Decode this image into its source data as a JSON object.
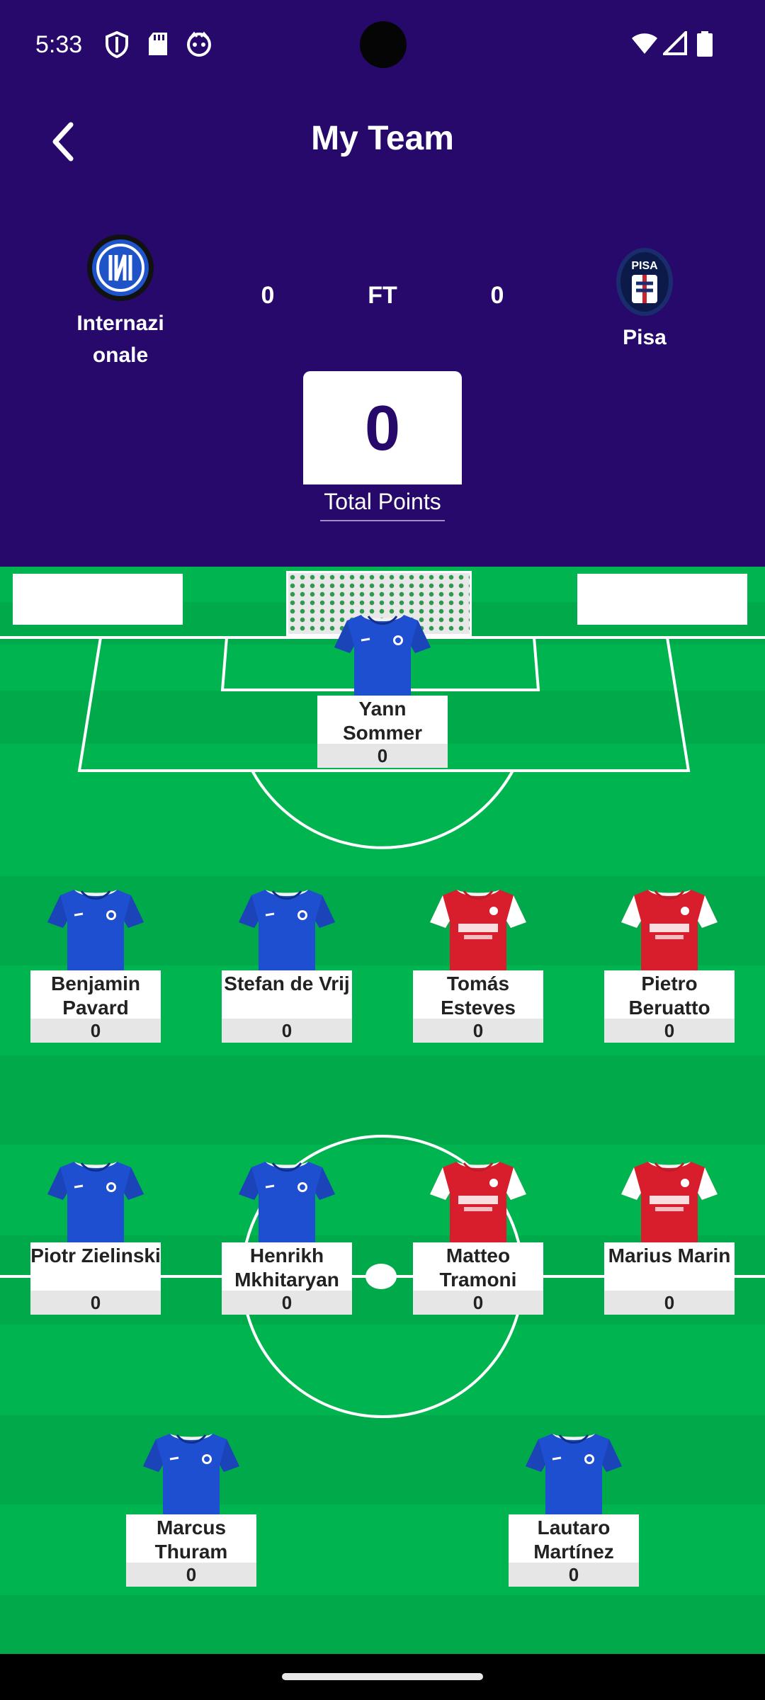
{
  "status_bar": {
    "time": "5:33",
    "left_icons": [
      "shield-icon",
      "sd-card-icon",
      "face-icon"
    ],
    "right_icons": [
      "wifi-icon",
      "signal-icon",
      "battery-icon"
    ]
  },
  "header": {
    "title": "My Team",
    "back_icon": "chevron-left-icon",
    "background": "#26096b"
  },
  "match": {
    "home_team": "Internazi onale",
    "away_team": "Pisa",
    "home_score": "0",
    "away_score": "0",
    "status": "FT"
  },
  "total_points": {
    "value": "0",
    "label": "Total Points"
  },
  "pitch_colors": {
    "light": "#00b44f",
    "dark": "#00a94a"
  },
  "players": [
    {
      "name": "Yann Sommer",
      "points": "0",
      "kit": "blue"
    },
    {
      "name": "Benjamin Pavard",
      "points": "0",
      "kit": "blue"
    },
    {
      "name": "Stefan de Vrij",
      "points": "0",
      "kit": "blue"
    },
    {
      "name": "Tomás Esteves",
      "points": "0",
      "kit": "red"
    },
    {
      "name": "Pietro Beruatto",
      "points": "0",
      "kit": "red"
    },
    {
      "name": "Piotr Zielinski",
      "points": "0",
      "kit": "blue"
    },
    {
      "name": "Henrikh Mkhitaryan",
      "points": "0",
      "kit": "blue"
    },
    {
      "name": "Matteo Tramoni",
      "points": "0",
      "kit": "red"
    },
    {
      "name": "Marius Marin",
      "points": "0",
      "kit": "red"
    },
    {
      "name": "Marcus Thuram",
      "points": "0",
      "kit": "blue"
    },
    {
      "name": "Lautaro Martínez",
      "points": "0",
      "kit": "blue"
    }
  ]
}
